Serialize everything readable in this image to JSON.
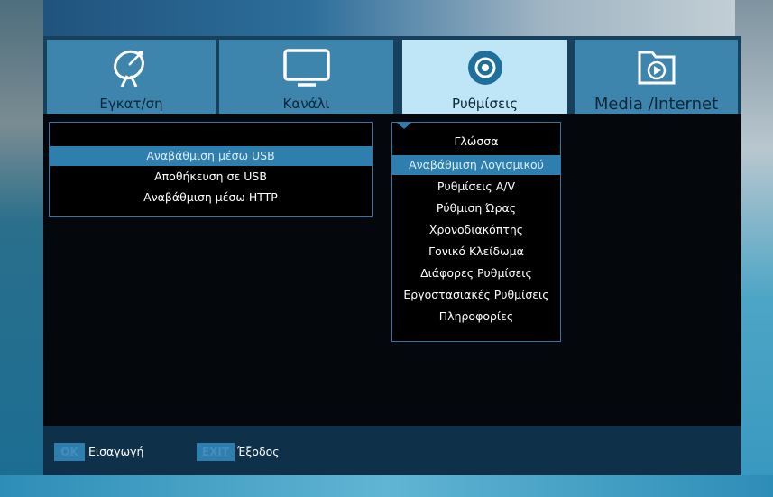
{
  "tabs": [
    {
      "label": "Εγκατ/ση",
      "icon": "satellite-dish-icon"
    },
    {
      "label": "Κανάλι",
      "icon": "tv-icon"
    },
    {
      "label": "Ρυθμίσεις",
      "icon": "settings-icon"
    },
    {
      "label": "Media /Internet",
      "icon": "media-folder-icon"
    }
  ],
  "active_tab": 2,
  "submenu": {
    "items": [
      {
        "label": "Αναβάθμιση μέσω USB",
        "selected": true
      },
      {
        "label": "Αποθήκευση σε USB",
        "selected": false
      },
      {
        "label": "Αναβάθμιση μέσω HTTP",
        "selected": false
      }
    ]
  },
  "settings_menu": {
    "items": [
      {
        "label": "Γλώσσα",
        "selected": false
      },
      {
        "label": "Αναβάθμιση Λογισμικού",
        "selected": true
      },
      {
        "label": "Ρυθμίσεις A/V",
        "selected": false
      },
      {
        "label": "Ρύθμιση Ώρας",
        "selected": false
      },
      {
        "label": "Χρονοδιακόπτης",
        "selected": false
      },
      {
        "label": "Γονικό Κλείδωμα",
        "selected": false
      },
      {
        "label": "Διάφορες Ρυθμίσεις",
        "selected": false
      },
      {
        "label": "Εργοστασιακές Ρυθμίσεις",
        "selected": false
      },
      {
        "label": "Πληροφορίες",
        "selected": false
      }
    ]
  },
  "footer": {
    "ok_key": "OK",
    "ok_label": "Εισαγωγή",
    "exit_key": "EXIT",
    "exit_label": "Έξοδος"
  },
  "colors": {
    "tab_active": "#bfe6f6",
    "tab_inactive": "#3d85ad",
    "highlight": "#2f7fae",
    "panel_border": "#2d77a8"
  }
}
